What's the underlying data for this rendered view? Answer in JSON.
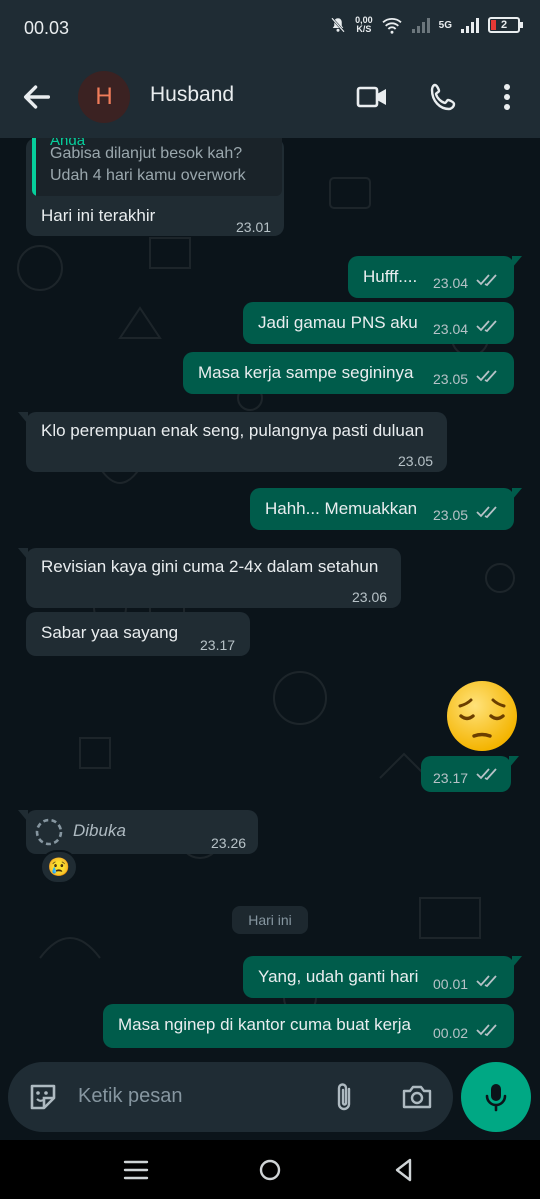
{
  "status_bar": {
    "time": "00.03",
    "speed_value": "0,00",
    "speed_unit": "K/S",
    "network": "5G",
    "battery": "2"
  },
  "header": {
    "avatar_letter": "H",
    "contact_name": "Husband",
    "icons": [
      "back-arrow-icon",
      "video-call-icon",
      "phone-icon",
      "more-vert-icon"
    ]
  },
  "messages": [
    {
      "dir": "in",
      "quote_author": "Anda",
      "quote_text": "Gabisa dilanjut besok kah?\nUdah 4 hari kamu overwork",
      "text": "Hari ini terakhir",
      "time": "23.01"
    },
    {
      "dir": "out",
      "text": "Hufff....",
      "time": "23.04"
    },
    {
      "dir": "out",
      "text": "Jadi gamau PNS aku",
      "time": "23.04"
    },
    {
      "dir": "out",
      "text": "Masa kerja sampe segininya",
      "time": "23.05"
    },
    {
      "dir": "in",
      "text": "Klo perempuan enak seng, pulangnya pasti duluan",
      "time": "23.05"
    },
    {
      "dir": "out",
      "text": "Hahh... Memuakkan",
      "time": "23.05"
    },
    {
      "dir": "in",
      "text": "Revisian kaya gini cuma 2-4x dalam setahun",
      "time": "23.06"
    },
    {
      "dir": "in",
      "text": "Sabar yaa sayang",
      "time": "23.17"
    },
    {
      "dir": "out",
      "emoji": "pensive-face",
      "time": "23.17"
    },
    {
      "dir": "in",
      "text": "Dibuka",
      "time": "23.26",
      "reaction": "😢"
    },
    {
      "dir": "out",
      "text": "Yang, udah ganti hari",
      "time": "00.01"
    },
    {
      "dir": "out",
      "text": "Masa nginep di kantor cuma buat kerja",
      "time": "00.02"
    }
  ],
  "date_divider": "Hari ini",
  "composer": {
    "placeholder": "Ketik pesan",
    "icons": [
      "sticker-icon",
      "attach-icon",
      "camera-icon",
      "mic-icon"
    ]
  },
  "colors": {
    "header_bg": "#1f2c34",
    "chat_bg": "#0b141a",
    "incoming_bubble": "#202c33",
    "outgoing_bubble": "#005c4b",
    "accent": "#00a884",
    "read_ticks": "#b7c2c7"
  }
}
